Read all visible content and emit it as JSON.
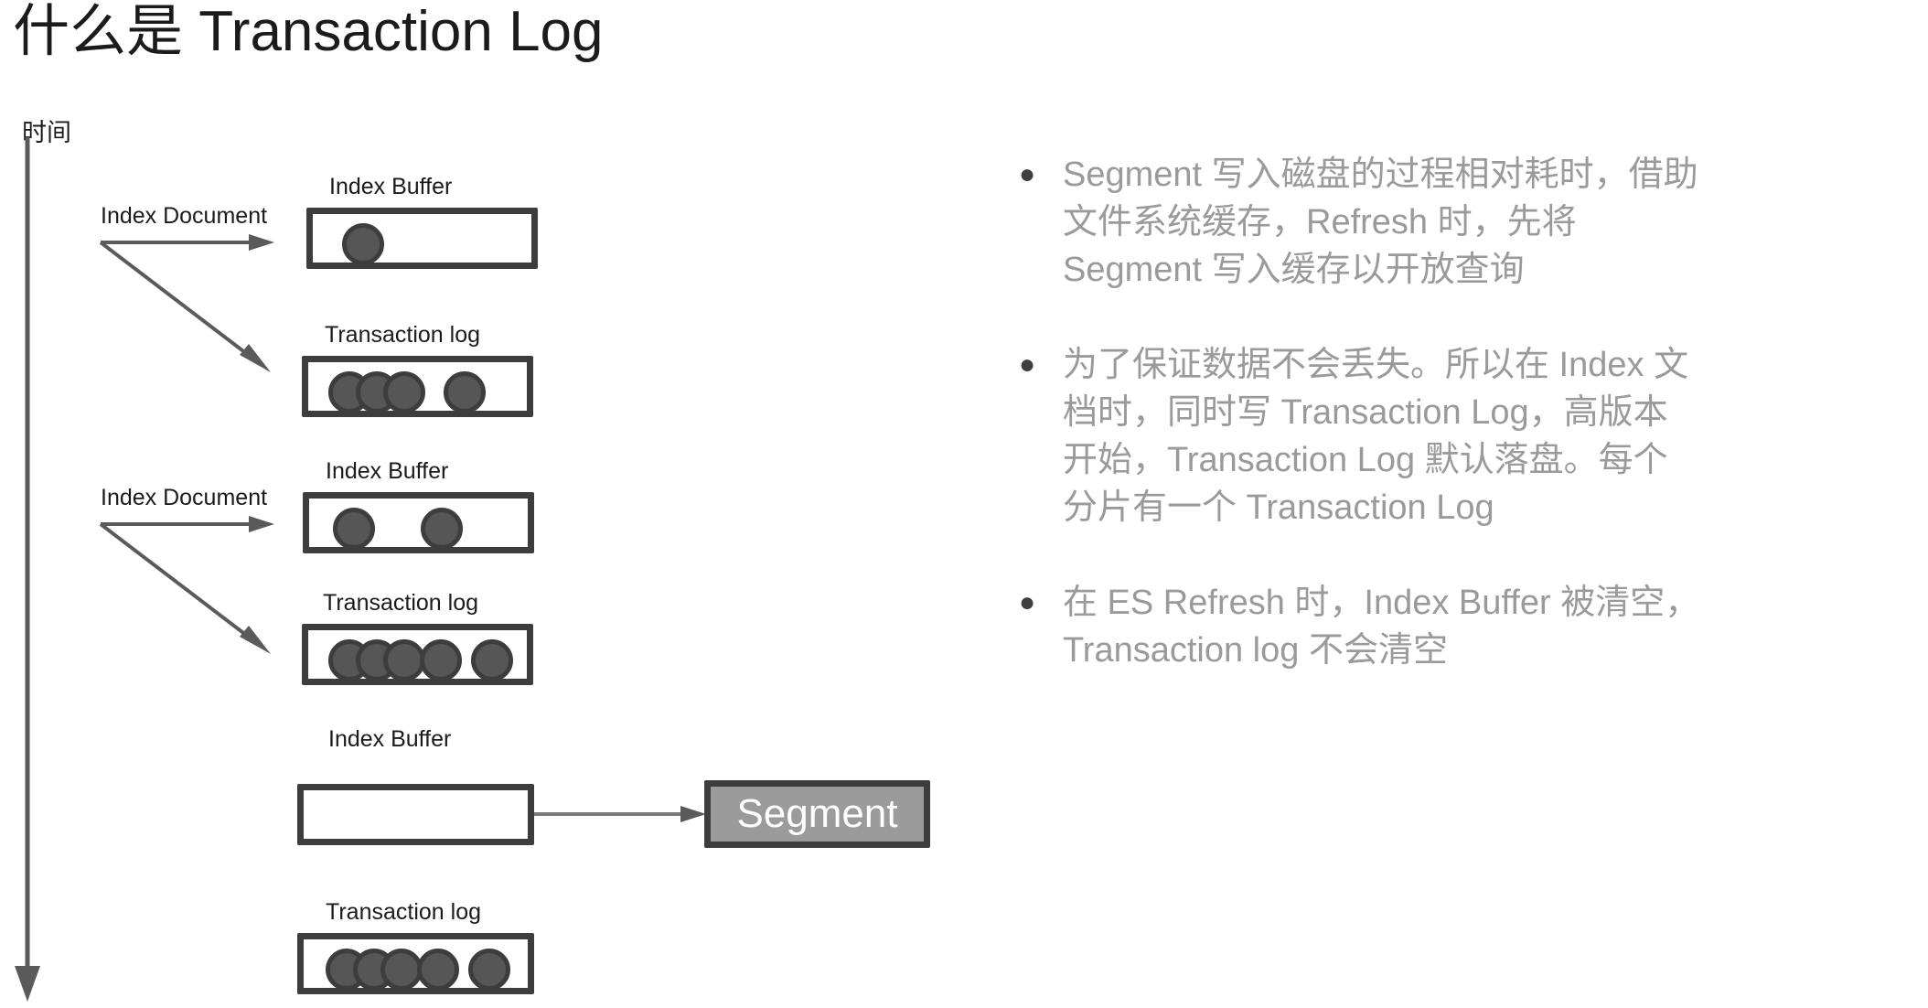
{
  "title": "什么是 Transaction Log",
  "colors": {
    "text_dark": "#1b1b1b",
    "bullet_text": "#9a9a9a",
    "box_border": "#3d3d3d",
    "dot_fill": "#565656",
    "segment_fill": "#9b9b9b",
    "segment_text": "#ffffff",
    "arrow": "#5a5a5a",
    "background": "#ffffff"
  },
  "timeline": {
    "label": "时间",
    "direction": "down"
  },
  "diagram": {
    "stages": [
      {
        "flow_label": "Index Document",
        "buffer_label": "Index Buffer",
        "buffer_dots": 1,
        "log_label": "Transaction log",
        "log_dots": 4
      },
      {
        "flow_label": "Index Document",
        "buffer_label": "Index Buffer",
        "buffer_dots": 2,
        "log_label": "Transaction log",
        "log_dots": 5
      },
      {
        "flow_label": "",
        "buffer_label": "Index Buffer",
        "buffer_dots": 0,
        "log_label": "Transaction log",
        "log_dots": 5
      }
    ],
    "segment_label": "Segment"
  },
  "bullets": [
    {
      "marker": "●",
      "lines": [
        "Segment 写入磁盘的过程相对耗时，借助",
        "文件系统缓存，Refresh 时，先将",
        "Segment 写入缓存以开放查询"
      ]
    },
    {
      "marker": "●",
      "lines": [
        "为了保证数据不会丢失。所以在 Index 文",
        "档时，同时写 Transaction Log，高版本",
        "开始，Transaction Log 默认落盘。每个",
        "分片有一个 Transaction Log"
      ]
    },
    {
      "marker": "●",
      "lines": [
        "在 ES Refresh 时，Index Buffer 被清空，",
        "Transaction log 不会清空"
      ]
    }
  ]
}
